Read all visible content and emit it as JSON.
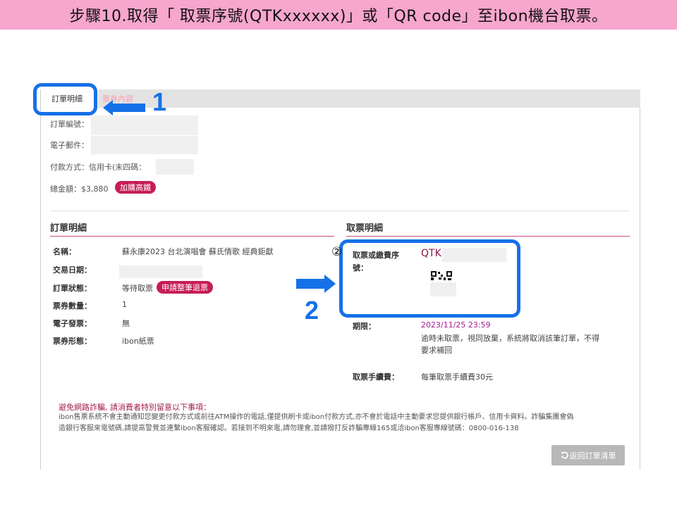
{
  "banner": {
    "title": "步驟10.取得「 取票序號(QTKxxxxxx)」或「QR code」至ibon機台取票。"
  },
  "tabs": [
    {
      "label": "訂單明細"
    },
    {
      "label": "票券內容"
    }
  ],
  "order_summary": {
    "order_no_label": "訂單編號：",
    "email_label": "電子郵件：",
    "payment_label": "付款方式：信用卡(末四碼：",
    "total_label": "總金額：$3,880",
    "rail_badge": "加購高鐵"
  },
  "order_detail": {
    "title": "訂單明細",
    "rows": [
      {
        "key": "名稱：",
        "value": "蘇永康2023  台北演唱會  蘇氏情歌  經典鉅獻"
      },
      {
        "key": "交易日期：",
        "value": ""
      },
      {
        "key": "訂單狀態：",
        "value": "等待取票"
      },
      {
        "key": "票券數量：",
        "value": "1"
      },
      {
        "key": "電子發票：",
        "value": "無"
      },
      {
        "key": "票券形態：",
        "value": "ibon紙票"
      }
    ],
    "refund_badge": "申請整筆退票"
  },
  "pickup_detail": {
    "title": "取票明細",
    "serial_key_line1": "取票或繳費序",
    "serial_key_line2": "號：",
    "serial_value": "QTK",
    "deadline_key": "期限：",
    "deadline_value": "2023/11/25  23:59",
    "deadline_note_1": "逾時未取票，視同放棄，系統將取消該筆訂單，不得",
    "deadline_note_2": "要求補回",
    "fee_key": "取票手續費：",
    "fee_value": "每筆取票手續費30元"
  },
  "warning": {
    "title": "避免網路詐騙, 請消費者特別留意以下事項：",
    "line1": "ibon售票系統不會主動通知您變更付款方式或前往ATM操作的電話,僅提供刷卡或ibon付款方式,亦不會於電話中主動要求您提供銀行帳戶、信用卡資料。詐騙集團會偽",
    "line2": "造銀行客服來電號碼,請提高警覺並連繫ibon客服確認。若接到不明來電,請勿理會,並請撥打反詐騙專線165或洽ibon客服專線號碼：0800-016-138"
  },
  "back_button": {
    "label": "返回訂單清單",
    "icon": "undo-icon"
  },
  "annotations": {
    "num1": "1",
    "num2": "2",
    "circled2": "②"
  },
  "colors": {
    "banner_bg": "#f7a6cd",
    "accent_maroon": "#8d1747",
    "badge_red": "#c61d55",
    "annotation_blue": "#1670e8"
  }
}
